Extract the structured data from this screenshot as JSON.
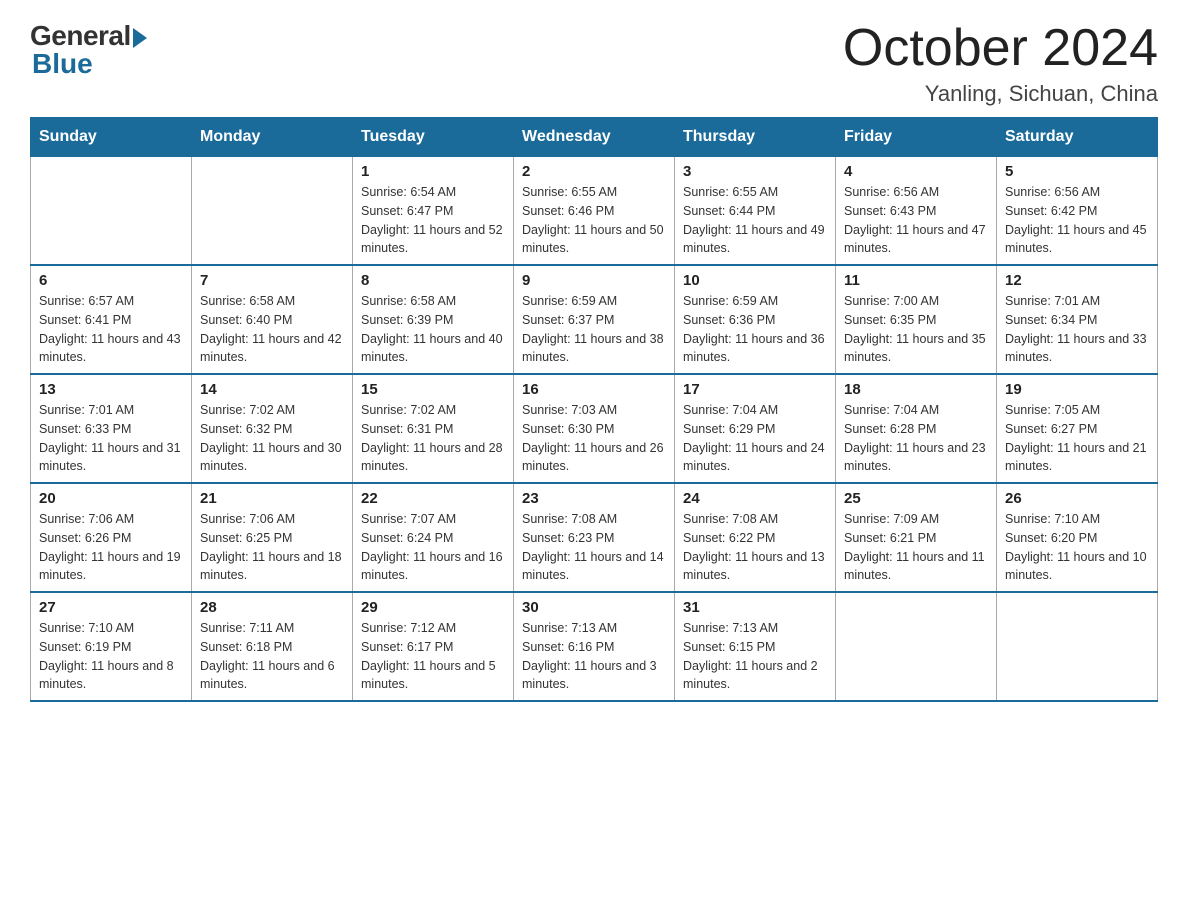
{
  "header": {
    "logo_general": "General",
    "logo_blue": "Blue",
    "month_title": "October 2024",
    "location": "Yanling, Sichuan, China"
  },
  "calendar": {
    "days_of_week": [
      "Sunday",
      "Monday",
      "Tuesday",
      "Wednesday",
      "Thursday",
      "Friday",
      "Saturday"
    ],
    "weeks": [
      [
        {
          "day": "",
          "sunrise": "",
          "sunset": "",
          "daylight": ""
        },
        {
          "day": "",
          "sunrise": "",
          "sunset": "",
          "daylight": ""
        },
        {
          "day": "1",
          "sunrise": "Sunrise: 6:54 AM",
          "sunset": "Sunset: 6:47 PM",
          "daylight": "Daylight: 11 hours and 52 minutes."
        },
        {
          "day": "2",
          "sunrise": "Sunrise: 6:55 AM",
          "sunset": "Sunset: 6:46 PM",
          "daylight": "Daylight: 11 hours and 50 minutes."
        },
        {
          "day": "3",
          "sunrise": "Sunrise: 6:55 AM",
          "sunset": "Sunset: 6:44 PM",
          "daylight": "Daylight: 11 hours and 49 minutes."
        },
        {
          "day": "4",
          "sunrise": "Sunrise: 6:56 AM",
          "sunset": "Sunset: 6:43 PM",
          "daylight": "Daylight: 11 hours and 47 minutes."
        },
        {
          "day": "5",
          "sunrise": "Sunrise: 6:56 AM",
          "sunset": "Sunset: 6:42 PM",
          "daylight": "Daylight: 11 hours and 45 minutes."
        }
      ],
      [
        {
          "day": "6",
          "sunrise": "Sunrise: 6:57 AM",
          "sunset": "Sunset: 6:41 PM",
          "daylight": "Daylight: 11 hours and 43 minutes."
        },
        {
          "day": "7",
          "sunrise": "Sunrise: 6:58 AM",
          "sunset": "Sunset: 6:40 PM",
          "daylight": "Daylight: 11 hours and 42 minutes."
        },
        {
          "day": "8",
          "sunrise": "Sunrise: 6:58 AM",
          "sunset": "Sunset: 6:39 PM",
          "daylight": "Daylight: 11 hours and 40 minutes."
        },
        {
          "day": "9",
          "sunrise": "Sunrise: 6:59 AM",
          "sunset": "Sunset: 6:37 PM",
          "daylight": "Daylight: 11 hours and 38 minutes."
        },
        {
          "day": "10",
          "sunrise": "Sunrise: 6:59 AM",
          "sunset": "Sunset: 6:36 PM",
          "daylight": "Daylight: 11 hours and 36 minutes."
        },
        {
          "day": "11",
          "sunrise": "Sunrise: 7:00 AM",
          "sunset": "Sunset: 6:35 PM",
          "daylight": "Daylight: 11 hours and 35 minutes."
        },
        {
          "day": "12",
          "sunrise": "Sunrise: 7:01 AM",
          "sunset": "Sunset: 6:34 PM",
          "daylight": "Daylight: 11 hours and 33 minutes."
        }
      ],
      [
        {
          "day": "13",
          "sunrise": "Sunrise: 7:01 AM",
          "sunset": "Sunset: 6:33 PM",
          "daylight": "Daylight: 11 hours and 31 minutes."
        },
        {
          "day": "14",
          "sunrise": "Sunrise: 7:02 AM",
          "sunset": "Sunset: 6:32 PM",
          "daylight": "Daylight: 11 hours and 30 minutes."
        },
        {
          "day": "15",
          "sunrise": "Sunrise: 7:02 AM",
          "sunset": "Sunset: 6:31 PM",
          "daylight": "Daylight: 11 hours and 28 minutes."
        },
        {
          "day": "16",
          "sunrise": "Sunrise: 7:03 AM",
          "sunset": "Sunset: 6:30 PM",
          "daylight": "Daylight: 11 hours and 26 minutes."
        },
        {
          "day": "17",
          "sunrise": "Sunrise: 7:04 AM",
          "sunset": "Sunset: 6:29 PM",
          "daylight": "Daylight: 11 hours and 24 minutes."
        },
        {
          "day": "18",
          "sunrise": "Sunrise: 7:04 AM",
          "sunset": "Sunset: 6:28 PM",
          "daylight": "Daylight: 11 hours and 23 minutes."
        },
        {
          "day": "19",
          "sunrise": "Sunrise: 7:05 AM",
          "sunset": "Sunset: 6:27 PM",
          "daylight": "Daylight: 11 hours and 21 minutes."
        }
      ],
      [
        {
          "day": "20",
          "sunrise": "Sunrise: 7:06 AM",
          "sunset": "Sunset: 6:26 PM",
          "daylight": "Daylight: 11 hours and 19 minutes."
        },
        {
          "day": "21",
          "sunrise": "Sunrise: 7:06 AM",
          "sunset": "Sunset: 6:25 PM",
          "daylight": "Daylight: 11 hours and 18 minutes."
        },
        {
          "day": "22",
          "sunrise": "Sunrise: 7:07 AM",
          "sunset": "Sunset: 6:24 PM",
          "daylight": "Daylight: 11 hours and 16 minutes."
        },
        {
          "day": "23",
          "sunrise": "Sunrise: 7:08 AM",
          "sunset": "Sunset: 6:23 PM",
          "daylight": "Daylight: 11 hours and 14 minutes."
        },
        {
          "day": "24",
          "sunrise": "Sunrise: 7:08 AM",
          "sunset": "Sunset: 6:22 PM",
          "daylight": "Daylight: 11 hours and 13 minutes."
        },
        {
          "day": "25",
          "sunrise": "Sunrise: 7:09 AM",
          "sunset": "Sunset: 6:21 PM",
          "daylight": "Daylight: 11 hours and 11 minutes."
        },
        {
          "day": "26",
          "sunrise": "Sunrise: 7:10 AM",
          "sunset": "Sunset: 6:20 PM",
          "daylight": "Daylight: 11 hours and 10 minutes."
        }
      ],
      [
        {
          "day": "27",
          "sunrise": "Sunrise: 7:10 AM",
          "sunset": "Sunset: 6:19 PM",
          "daylight": "Daylight: 11 hours and 8 minutes."
        },
        {
          "day": "28",
          "sunrise": "Sunrise: 7:11 AM",
          "sunset": "Sunset: 6:18 PM",
          "daylight": "Daylight: 11 hours and 6 minutes."
        },
        {
          "day": "29",
          "sunrise": "Sunrise: 7:12 AM",
          "sunset": "Sunset: 6:17 PM",
          "daylight": "Daylight: 11 hours and 5 minutes."
        },
        {
          "day": "30",
          "sunrise": "Sunrise: 7:13 AM",
          "sunset": "Sunset: 6:16 PM",
          "daylight": "Daylight: 11 hours and 3 minutes."
        },
        {
          "day": "31",
          "sunrise": "Sunrise: 7:13 AM",
          "sunset": "Sunset: 6:15 PM",
          "daylight": "Daylight: 11 hours and 2 minutes."
        },
        {
          "day": "",
          "sunrise": "",
          "sunset": "",
          "daylight": ""
        },
        {
          "day": "",
          "sunrise": "",
          "sunset": "",
          "daylight": ""
        }
      ]
    ]
  }
}
